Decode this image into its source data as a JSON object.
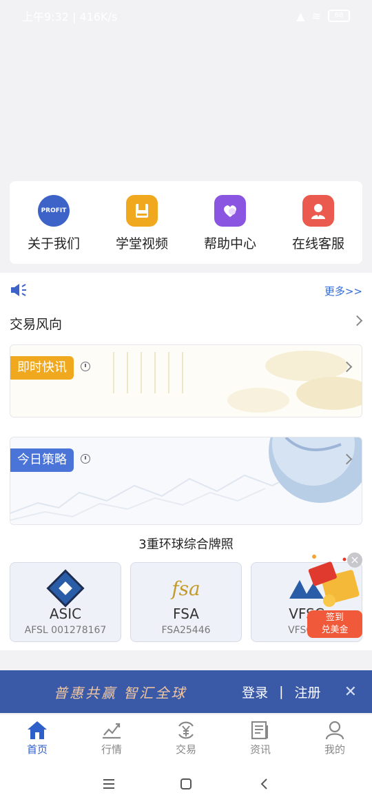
{
  "status_bar": {
    "time": "上午9:32",
    "speed": "416K/s",
    "battery": "68"
  },
  "quick_links": [
    {
      "label": "关于我们",
      "icon": "profit-logo-icon",
      "icon_text": "PROFIT",
      "color": "#3d63c9"
    },
    {
      "label": "学堂视频",
      "icon": "book-icon",
      "color": "#f0a81e"
    },
    {
      "label": "帮助中心",
      "icon": "heart-chat-icon",
      "color": "#8a55e0"
    },
    {
      "label": "在线客服",
      "icon": "customer-service-icon",
      "color": "#ea5a4e"
    }
  ],
  "notice": {
    "more": "更多>>"
  },
  "trend": {
    "title": "交易风向"
  },
  "cards": [
    {
      "tag": "即时快讯",
      "tag_color": "#f0a81e"
    },
    {
      "tag": "今日策略",
      "tag_color": "#4a74d8"
    }
  ],
  "licenses": {
    "title": "3重环球综合牌照",
    "items": [
      {
        "name": "ASIC",
        "code": "AFSL 001278167"
      },
      {
        "name": "FSA",
        "code": "FSA25446",
        "logo_text": "fsa"
      },
      {
        "name": "VFSC",
        "code": "VFSC40"
      }
    ]
  },
  "float_badge": {
    "line1": "签到",
    "line2": "兑美金",
    "close": "×"
  },
  "promo": {
    "slogan": "普惠共赢 智汇全球",
    "login": "登录",
    "separator": "|",
    "register": "注册",
    "close": "✕"
  },
  "tabs": [
    {
      "label": "首页",
      "icon": "home-icon",
      "active": true
    },
    {
      "label": "行情",
      "icon": "chart-icon",
      "active": false
    },
    {
      "label": "交易",
      "icon": "yen-exchange-icon",
      "active": false
    },
    {
      "label": "资讯",
      "icon": "news-icon",
      "active": false
    },
    {
      "label": "我的",
      "icon": "user-icon",
      "active": false
    }
  ],
  "colors": {
    "accent": "#2f5fc9",
    "tab_inactive": "#888888",
    "promo_bg": "#3a5aa8"
  }
}
